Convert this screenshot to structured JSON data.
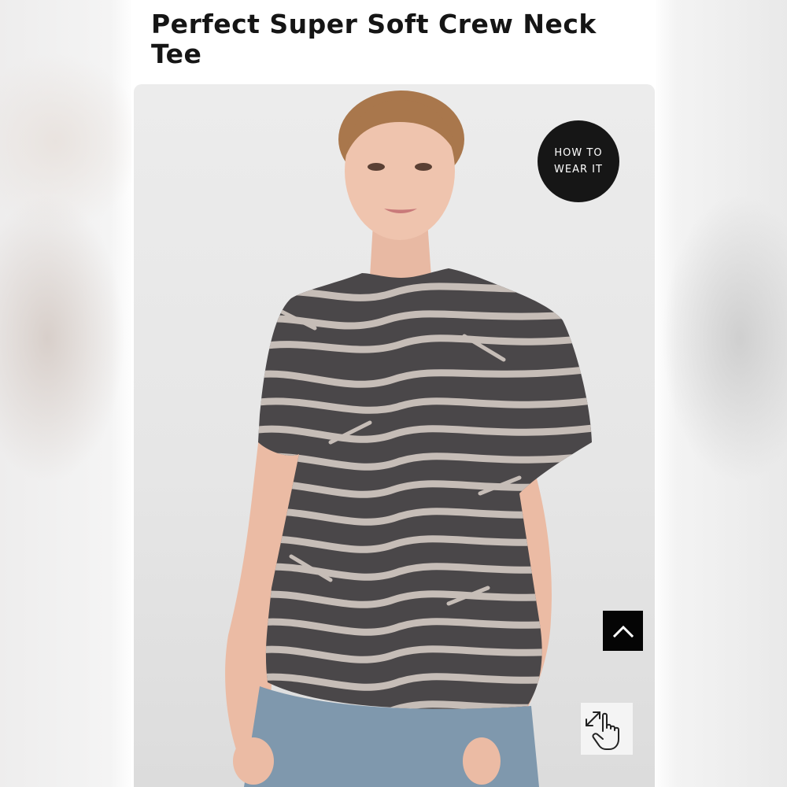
{
  "product": {
    "title": "Perfect Super Soft Crew Neck Tee"
  },
  "image": {
    "description_icon": "product-photo"
  },
  "badges": {
    "how_to_wear": "HOW TO WEAR IT"
  },
  "controls": {
    "back_to_top_icon": "chevron-up-icon",
    "zoom_icon": "pinch-zoom-hand-icon"
  },
  "colors": {
    "title": "#151515",
    "badge_bg": "#161616",
    "badge_text": "#ffffff",
    "button_bg": "#050505",
    "shirt_dark": "#4a4749",
    "shirt_stripe": "#c6bdb7"
  }
}
